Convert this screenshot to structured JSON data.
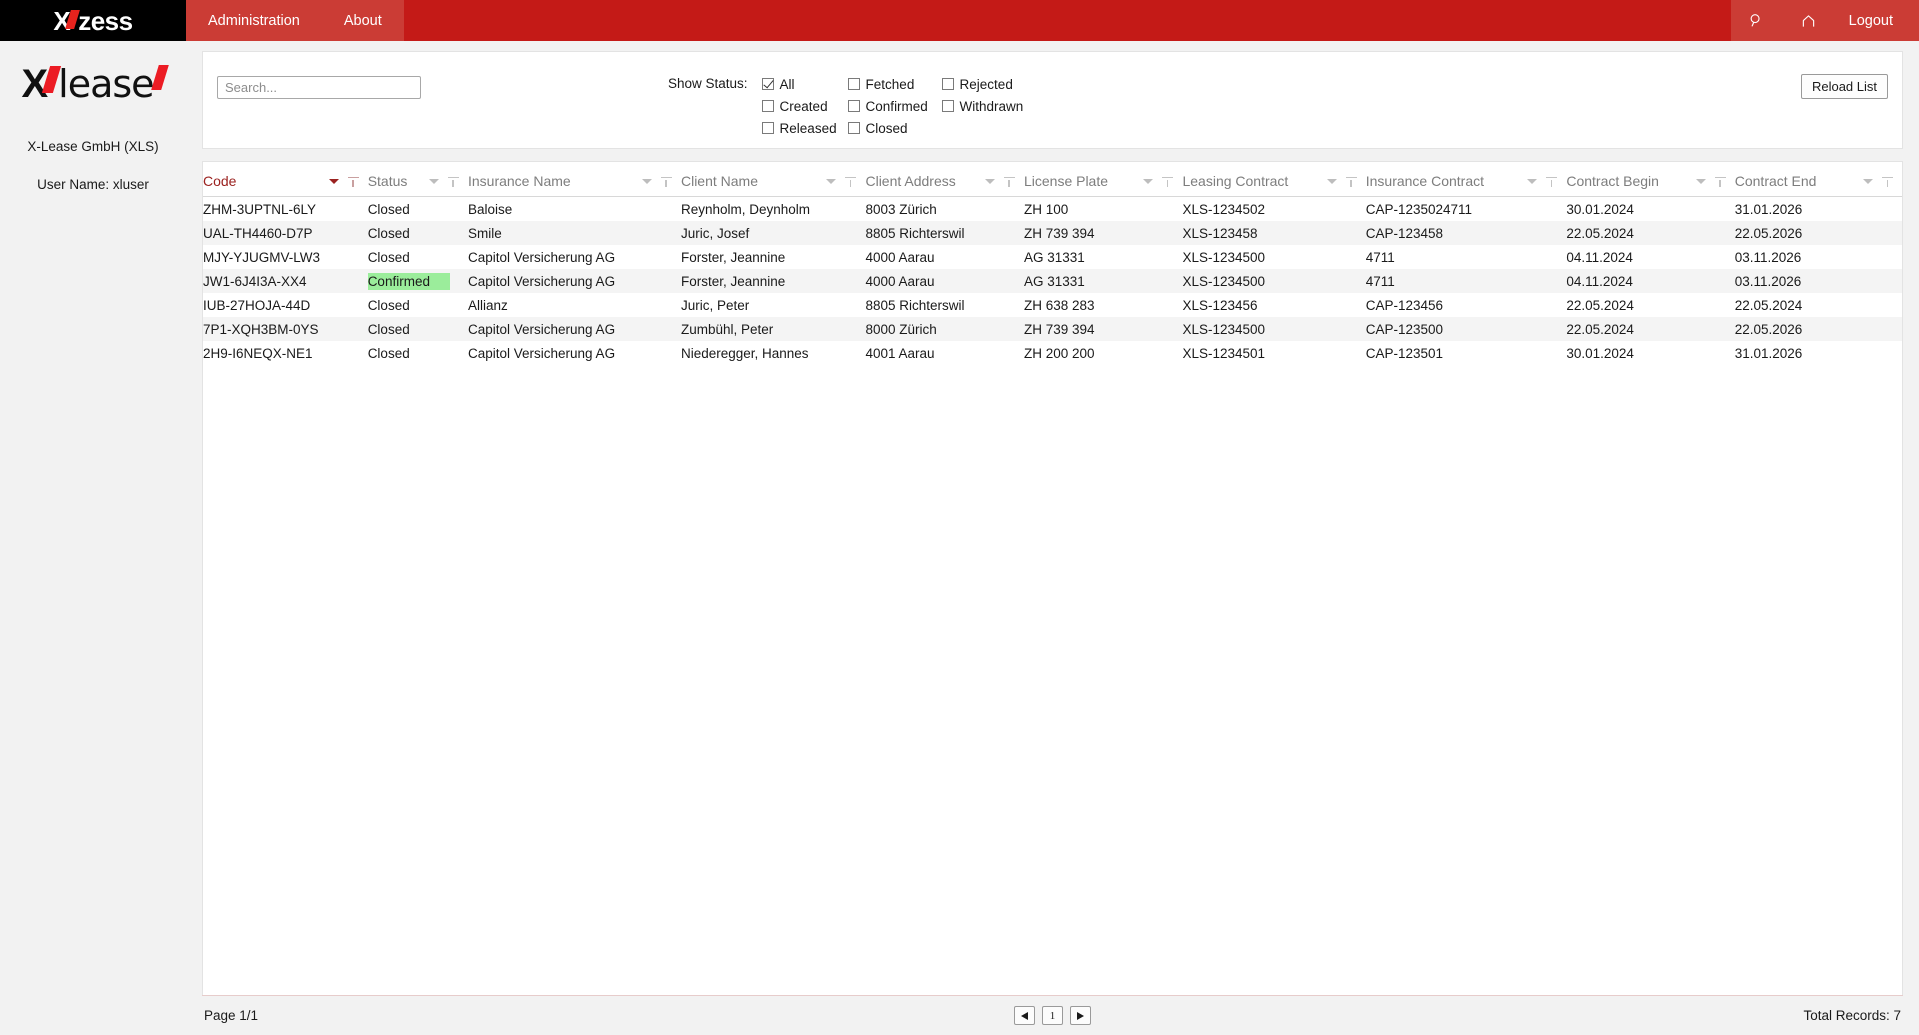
{
  "header": {
    "brand": {
      "x": "X",
      "suffix": "ess",
      "middle": "z"
    },
    "nav": [
      {
        "label": "Administration",
        "name": "nav-administration"
      },
      {
        "label": "About",
        "name": "nav-about"
      }
    ],
    "search_icon": "search-icon",
    "home_icon": "home-icon",
    "logout_label": "Logout"
  },
  "sidebar": {
    "logo_x": "X",
    "logo_lease": "lease",
    "company": "X-Lease GmbH (XLS)",
    "user": "User Name: xluser"
  },
  "filters": {
    "search_placeholder": "Search...",
    "search_value": "",
    "status_label": "Show Status:",
    "checkboxes": [
      {
        "label": "All",
        "checked": true
      },
      {
        "label": "Fetched",
        "checked": false
      },
      {
        "label": "Rejected",
        "checked": false
      },
      {
        "label": "Created",
        "checked": false
      },
      {
        "label": "Confirmed",
        "checked": false
      },
      {
        "label": "Withdrawn",
        "checked": false
      },
      {
        "label": "Released",
        "checked": false
      },
      {
        "label": "Closed",
        "checked": false
      },
      {
        "label": "",
        "checked": false
      }
    ],
    "reload_label": "Reload List"
  },
  "table": {
    "columns": [
      {
        "label": "Code",
        "sorted": true
      },
      {
        "label": "Status",
        "sorted": false
      },
      {
        "label": "Insurance Name",
        "sorted": false
      },
      {
        "label": "Client Name",
        "sorted": false
      },
      {
        "label": "Client Address",
        "sorted": false
      },
      {
        "label": "License Plate",
        "sorted": false
      },
      {
        "label": "Leasing Contract",
        "sorted": false
      },
      {
        "label": "Insurance Contract",
        "sorted": false
      },
      {
        "label": "Contract Begin",
        "sorted": false
      },
      {
        "label": "Contract End",
        "sorted": false
      }
    ],
    "rows": [
      {
        "code": "ZHM-3UPTNL-6LY",
        "status": "Closed",
        "status_highlight": false,
        "insurance_name": "Baloise",
        "client_name": "Reynholm, Deynholm",
        "client_address": "8003 Zürich",
        "license_plate": "ZH 100",
        "leasing_contract": "XLS-1234502",
        "insurance_contract": "CAP-1235024711",
        "contract_begin": "30.01.2024",
        "contract_end": "31.01.2026"
      },
      {
        "code": "UAL-TH4460-D7P",
        "status": "Closed",
        "status_highlight": false,
        "insurance_name": "Smile",
        "client_name": "Juric, Josef",
        "client_address": "8805 Richterswil",
        "license_plate": "ZH 739 394",
        "leasing_contract": "XLS-123458",
        "insurance_contract": "CAP-123458",
        "contract_begin": "22.05.2024",
        "contract_end": "22.05.2026"
      },
      {
        "code": "MJY-YJUGMV-LW3",
        "status": "Closed",
        "status_highlight": false,
        "insurance_name": "Capitol Versicherung AG",
        "client_name": "Forster, Jeannine",
        "client_address": "4000 Aarau",
        "license_plate": "AG 31331",
        "leasing_contract": "XLS-1234500",
        "insurance_contract": "4711",
        "contract_begin": "04.11.2024",
        "contract_end": "03.11.2026"
      },
      {
        "code": "JW1-6J4I3A-XX4",
        "status": "Confirmed",
        "status_highlight": true,
        "insurance_name": "Capitol Versicherung AG",
        "client_name": "Forster, Jeannine",
        "client_address": "4000 Aarau",
        "license_plate": "AG 31331",
        "leasing_contract": "XLS-1234500",
        "insurance_contract": "4711",
        "contract_begin": "04.11.2024",
        "contract_end": "03.11.2026"
      },
      {
        "code": "IUB-27HOJA-44D",
        "status": "Closed",
        "status_highlight": false,
        "insurance_name": "Allianz",
        "client_name": "Juric, Peter",
        "client_address": "8805 Richterswil",
        "license_plate": "ZH 638 283",
        "leasing_contract": "XLS-123456",
        "insurance_contract": "CAP-123456",
        "contract_begin": "22.05.2024",
        "contract_end": "22.05.2024"
      },
      {
        "code": "7P1-XQH3BM-0YS",
        "status": "Closed",
        "status_highlight": false,
        "insurance_name": "Capitol Versicherung AG",
        "client_name": "Zumbühl, Peter",
        "client_address": "8000 Zürich",
        "license_plate": "ZH 739 394",
        "leasing_contract": "XLS-1234500",
        "insurance_contract": "CAP-123500",
        "contract_begin": "22.05.2024",
        "contract_end": "22.05.2026"
      },
      {
        "code": "2H9-I6NEQX-NE1",
        "status": "Closed",
        "status_highlight": false,
        "insurance_name": "Capitol Versicherung AG",
        "client_name": "Niederegger, Hannes",
        "client_address": "4001 Aarau",
        "license_plate": "ZH 200 200",
        "leasing_contract": "XLS-1234501",
        "insurance_contract": "CAP-123501",
        "contract_begin": "30.01.2024",
        "contract_end": "31.01.2026"
      }
    ]
  },
  "footer": {
    "page_text": "Page 1/1",
    "prev_label": "prev-page-icon",
    "current_page": "1",
    "next_label": "next-page-icon",
    "total_records": "Total Records: 7"
  },
  "colors": {
    "brand_red": "#c41a17",
    "nav_red": "#cb3c35",
    "accent_red": "#ec1c24",
    "sorted_header": "#9b2220",
    "status_highlight": "#9bed9b"
  }
}
